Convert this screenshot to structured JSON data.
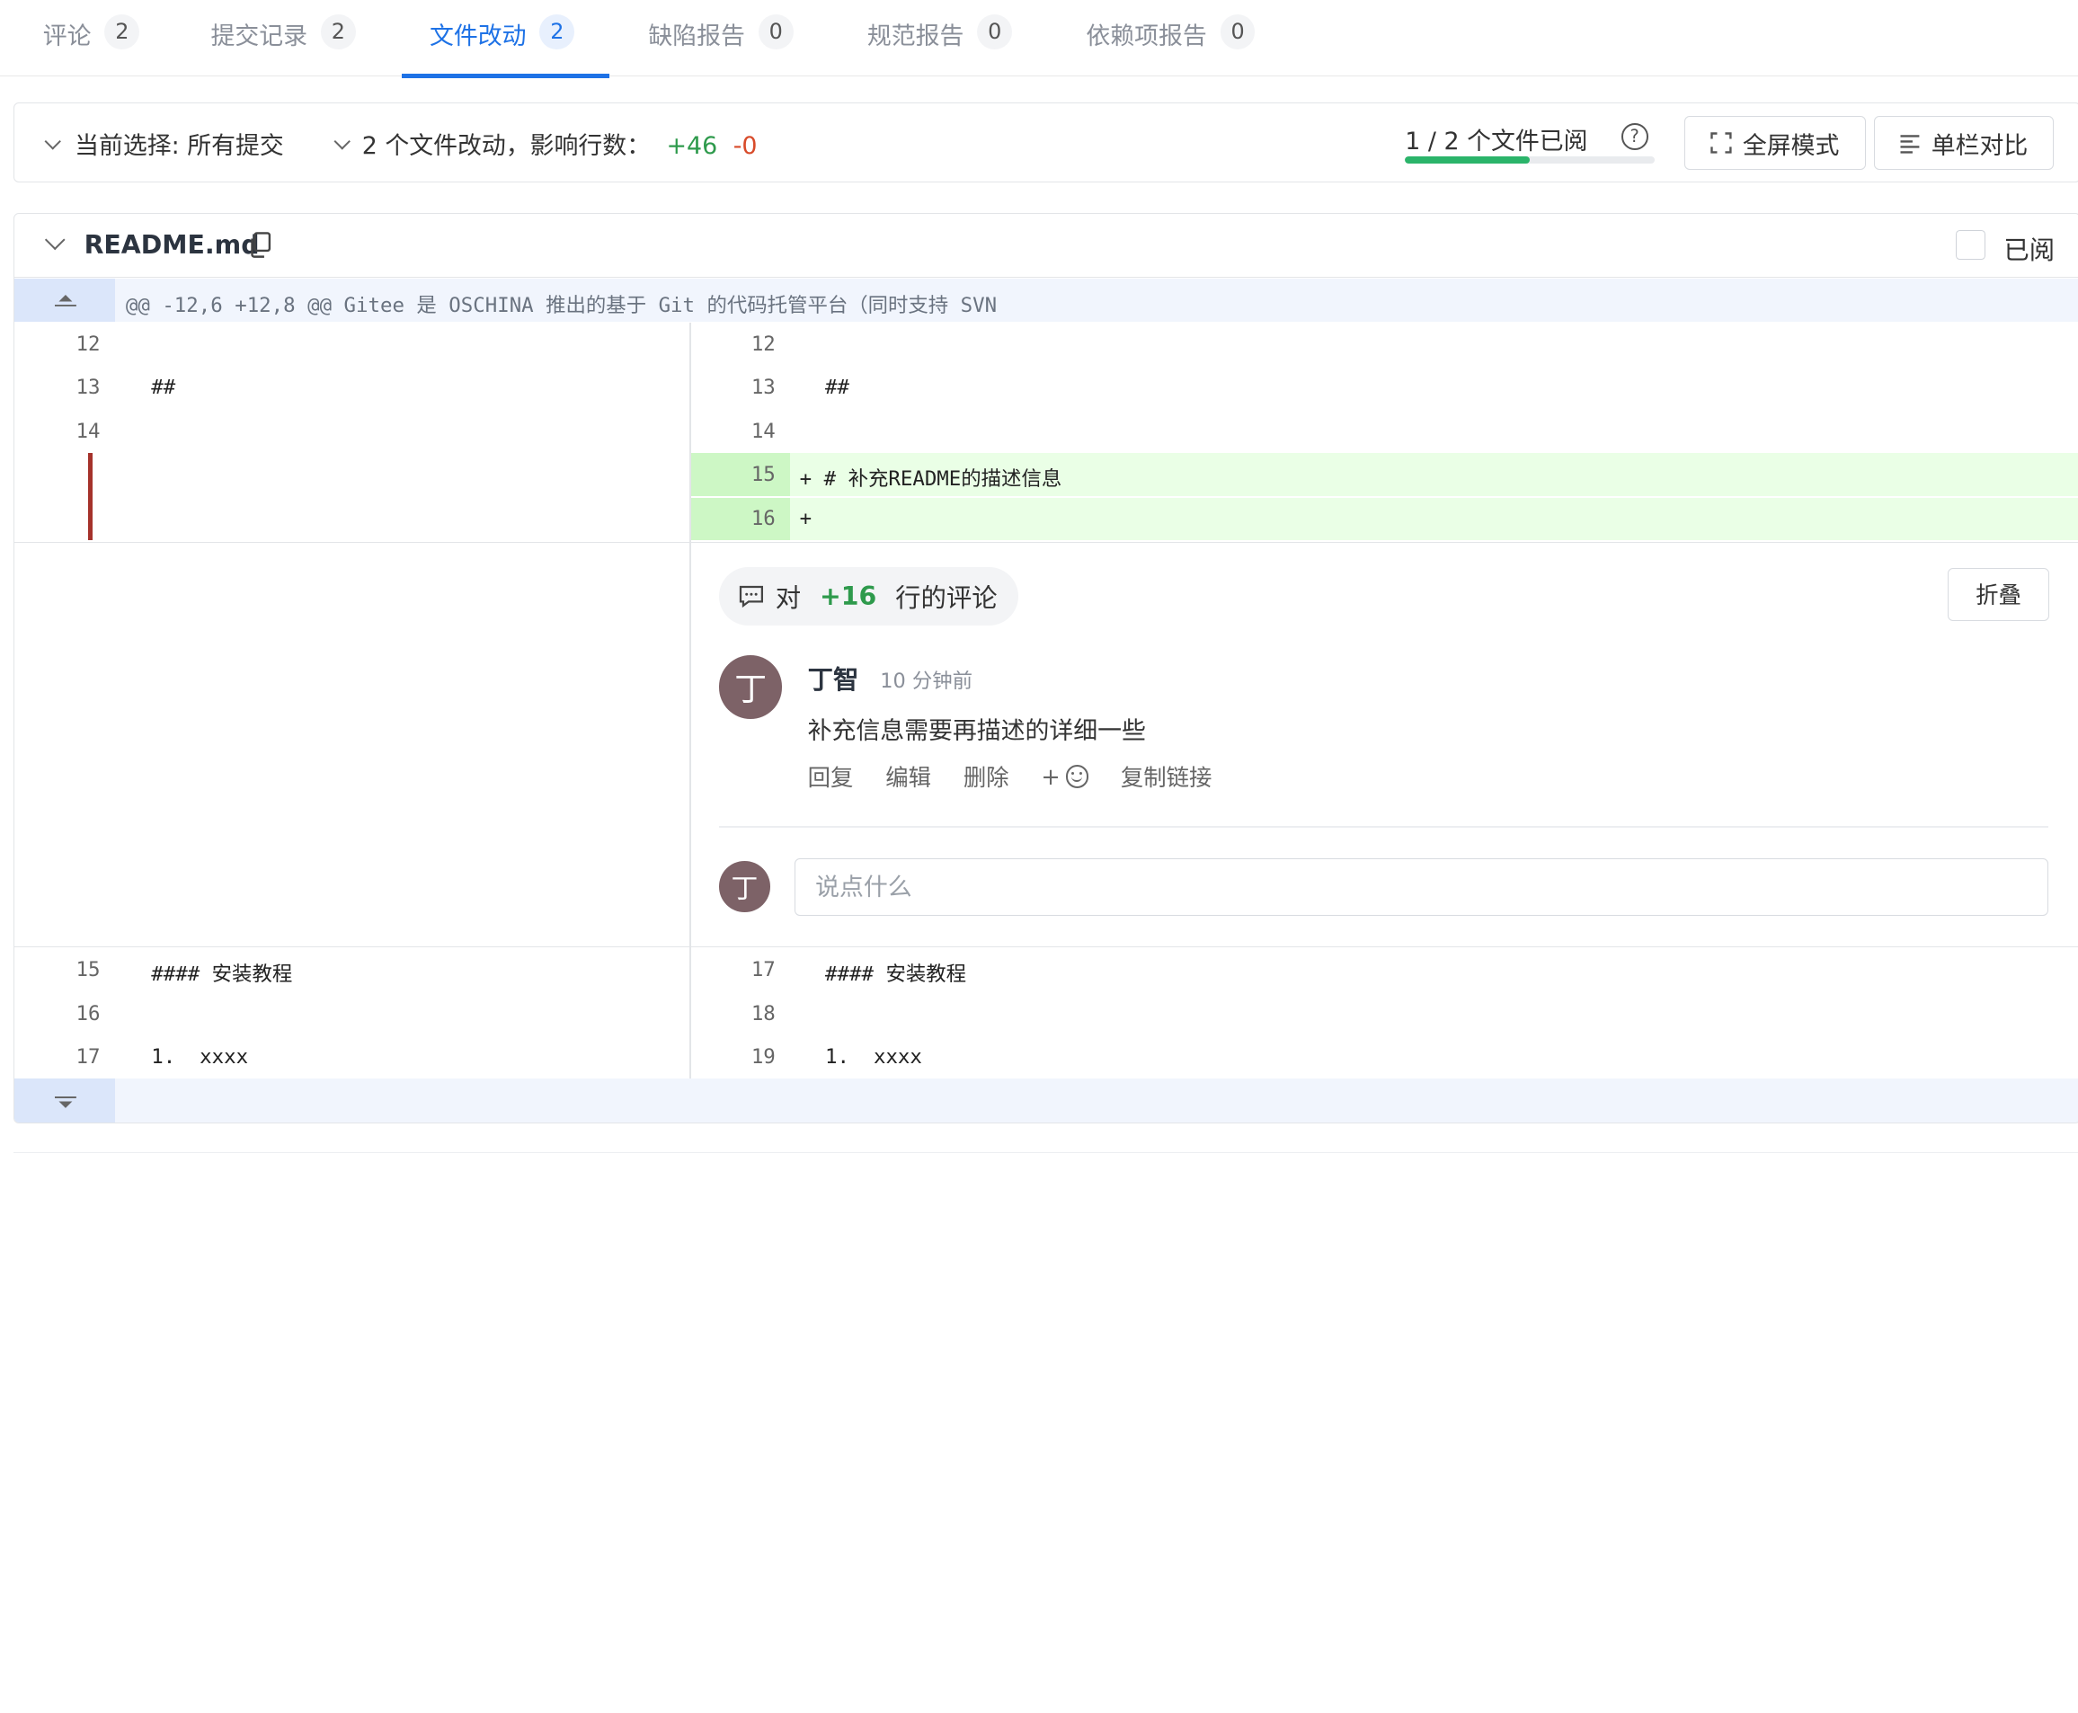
{
  "tabs": [
    {
      "label": "评论",
      "count": "2"
    },
    {
      "label": "提交记录",
      "count": "2"
    },
    {
      "label": "文件改动",
      "count": "2"
    },
    {
      "label": "缺陷报告",
      "count": "0"
    },
    {
      "label": "规范报告",
      "count": "0"
    },
    {
      "label": "依赖项报告",
      "count": "0"
    }
  ],
  "toolbar": {
    "selection": "当前选择: 所有提交",
    "summary": "2 个文件改动，影响行数：",
    "additions": "+46",
    "deletions": "-0",
    "progress_label": "1 / 2 个文件已阅",
    "progress_fraction": 0.5,
    "fullscreen_label": "全屏模式",
    "split_label": "单栏对比"
  },
  "file": {
    "name": "README.md",
    "viewed_label": "已阅",
    "hunk_header": "@@ -12,6 +12,8 @@ Gitee 是 OSCHINA 推出的基于 Git 的代码托管平台（同时支持 SVN",
    "rows_top": [
      {
        "old_ln": "12",
        "old_code": "",
        "new_ln": "12",
        "new_code": ""
      },
      {
        "old_ln": "13",
        "old_code": "##",
        "new_ln": "13",
        "new_code": "##"
      },
      {
        "old_ln": "14",
        "old_code": "",
        "new_ln": "14",
        "new_code": ""
      }
    ],
    "added_rows": [
      {
        "new_ln": "15",
        "new_code": "+ # 补充README的描述信息"
      },
      {
        "new_ln": "16",
        "new_code": "+"
      }
    ],
    "rows_bottom": [
      {
        "old_ln": "15",
        "old_code": "#### 安装教程",
        "new_ln": "17",
        "new_code": "#### 安装教程"
      },
      {
        "old_ln": "16",
        "old_code": "",
        "new_ln": "18",
        "new_code": ""
      },
      {
        "old_ln": "17",
        "old_code": "1.  xxxx",
        "new_ln": "19",
        "new_code": "1.  xxxx"
      }
    ]
  },
  "comment": {
    "tag_prefix": "对",
    "tag_line": "+16",
    "tag_suffix": "行的评论",
    "fold_label": "折叠",
    "avatar_char": "丁",
    "author": "丁智",
    "time": "10 分钟前",
    "body": "补充信息需要再描述的详细一些",
    "actions": {
      "reply": "回复",
      "edit": "编辑",
      "delete": "删除",
      "emoji_plus": "+",
      "copy_link": "复制链接"
    },
    "reply_placeholder": "说点什么"
  },
  "colors": {
    "accent": "#1e72e6",
    "add_bg": "#eaffe6",
    "add_count": "#2e9a4c",
    "del_count": "#d84b2a",
    "avatar_bg": "#7d6267"
  }
}
